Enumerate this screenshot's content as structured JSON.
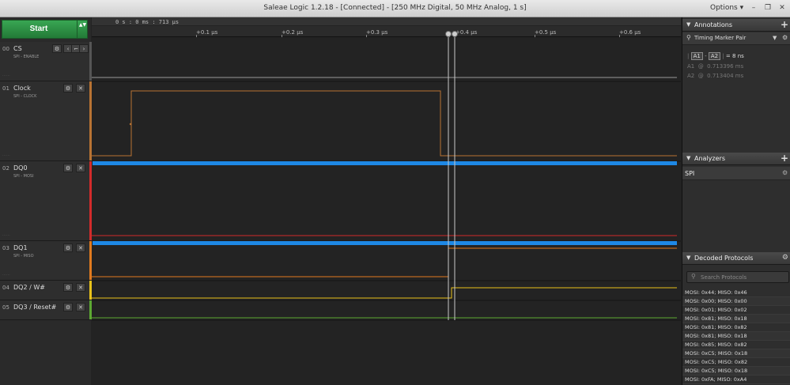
{
  "window": {
    "title": "Saleae Logic 1.2.18 - [Connected] - [250 MHz Digital, 50 MHz Analog, 1 s]",
    "options_label": "Options ▾",
    "minimize": "–",
    "restore": "❐",
    "close": "✕"
  },
  "start": {
    "label": "Start",
    "arrows": "▲▼"
  },
  "channels": [
    {
      "num": "00",
      "name": "CS",
      "sub": "SPI - ENABLE",
      "color": "#9a9a9a"
    },
    {
      "num": "01",
      "name": "Clock",
      "sub": "SPI - CLOCK",
      "color": "#b87333"
    },
    {
      "num": "02",
      "name": "DQ0",
      "sub": "SPI - MOSI",
      "color": "#d22b2b"
    },
    {
      "num": "03",
      "name": "DQ1",
      "sub": "SPI - MISO",
      "color": "#e07a1f"
    },
    {
      "num": "04",
      "name": "DQ2 / W#",
      "sub": "",
      "color": "#e8c21a"
    },
    {
      "num": "05",
      "name": "DQ3 / Reset#",
      "sub": "",
      "color": "#5da832"
    }
  ],
  "ruler": {
    "origin": "0 s : 0 ms : 713 μs",
    "ticks": [
      "+0.1 μs",
      "+0.2 μs",
      "+0.3 μs",
      "+0.4 μs",
      "+0.5 μs",
      "+0.6 μs"
    ]
  },
  "annotations": {
    "title": "Annotations",
    "marker_pair": "Timing Marker Pair",
    "a1": "A1",
    "a2": "A2",
    "dash": "-",
    "diff": "= 8 ns",
    "at": "@",
    "a1_value": "0.713396 ms",
    "a2_value": "0.713404 ms"
  },
  "analyzers": {
    "title": "Analyzers",
    "items": [
      "SPI"
    ]
  },
  "decoded": {
    "title": "Decoded Protocols",
    "search_placeholder": "Search Protocols",
    "rows": [
      "MOSI: 0x44;  MISO: 0x46",
      "MOSI: 0x00;  MISO: 0x00",
      "MOSI: 0x01;  MISO: 0x02",
      "MOSI: 0x81;  MISO: 0x18",
      "MOSI: 0x81;  MISO: 0x82",
      "MOSI: 0x81;  MISO: 0x18",
      "MOSI: 0x85;  MISO: 0x82",
      "MOSI: 0xC5;  MISO: 0x18",
      "MOSI: 0xC5;  MISO: 0x82",
      "MOSI: 0xC5;  MISO: 0x18",
      "MOSI: 0xFA;  MISO: 0xA4"
    ]
  },
  "colors": {
    "bus": "#1e88e5",
    "marker": "#c8c8c8",
    "accent": "#2e9a48"
  }
}
